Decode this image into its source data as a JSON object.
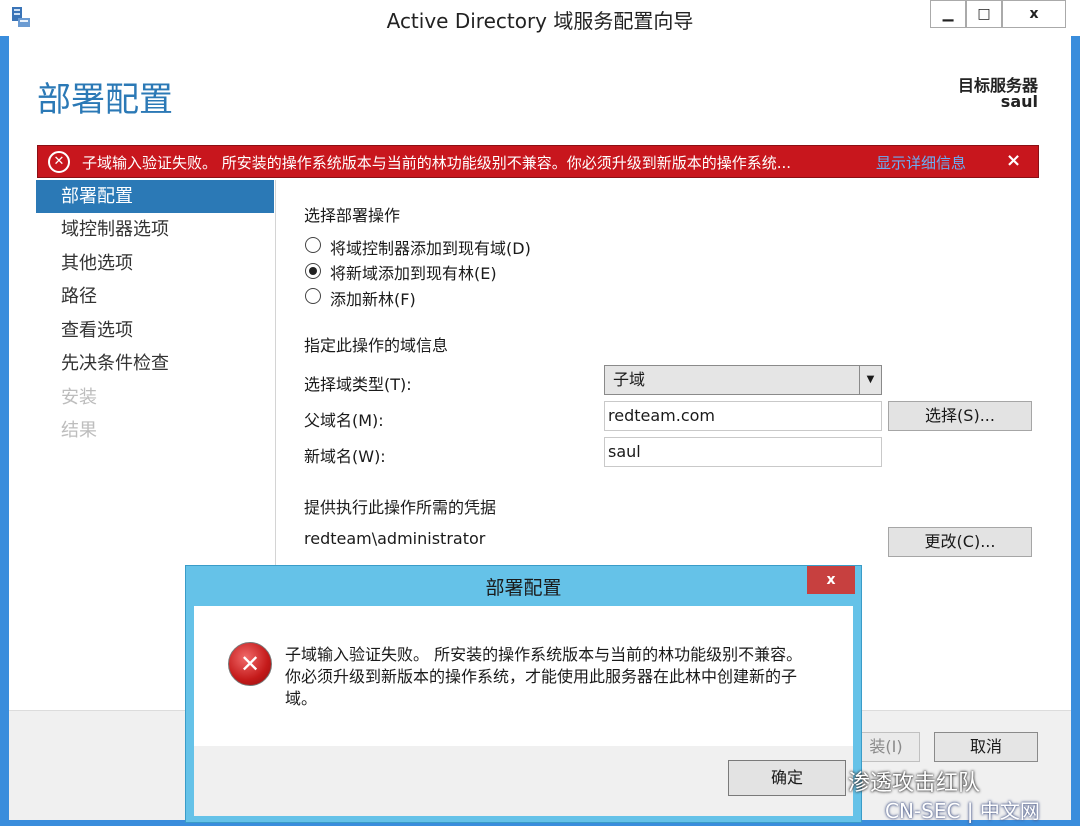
{
  "window": {
    "title": "Active Directory 域服务配置向导",
    "controls": {
      "minimize": "▁",
      "maximize": "□",
      "close": "x"
    }
  },
  "header": {
    "page_title": "部署配置",
    "target_label": "目标服务器",
    "target_name": "saul"
  },
  "error_bar": {
    "text": "子域输入验证失败。 所安装的操作系统版本与当前的林功能级别不兼容。你必须升级到新版本的操作系统...",
    "link": "显示详细信息",
    "close": "×"
  },
  "sidebar": {
    "items": [
      {
        "label": "部署配置",
        "state": "active"
      },
      {
        "label": "域控制器选项",
        "state": "normal"
      },
      {
        "label": "其他选项",
        "state": "normal"
      },
      {
        "label": "路径",
        "state": "normal"
      },
      {
        "label": "查看选项",
        "state": "normal"
      },
      {
        "label": "先决条件检查",
        "state": "normal"
      },
      {
        "label": "安装",
        "state": "disabled"
      },
      {
        "label": "结果",
        "state": "disabled"
      }
    ]
  },
  "main": {
    "deploy_heading": "选择部署操作",
    "radios": [
      {
        "label": "将域控制器添加到现有域(D)",
        "checked": false
      },
      {
        "label": "将新域添加到现有林(E)",
        "checked": true
      },
      {
        "label": "添加新林(F)",
        "checked": false
      }
    ],
    "domain_heading": "指定此操作的域信息",
    "domain_type_label": "选择域类型(T):",
    "domain_type_value": "子域",
    "parent_label": "父域名(M):",
    "parent_value": "redteam.com",
    "select_button": "选择(S)...",
    "new_label": "新域名(W):",
    "new_value": "saul",
    "cred_heading": "提供执行此操作所需的凭据",
    "cred_value": "redteam\\administrator",
    "change_button": "更改(C)..."
  },
  "footer": {
    "install_button": "装(I)",
    "cancel_button": "取消"
  },
  "dialog": {
    "title": "部署配置",
    "close": "x",
    "message": "子域输入验证失败。 所安装的操作系统版本与当前的林功能级别不兼容。你必须升级到新版本的操作系统，才能使用此服务器在此林中创建新的子域。",
    "ok_button": "确定"
  },
  "watermark": {
    "line1": "渗透攻击红队",
    "line2": "CN-SEC | 中文网"
  },
  "colors": {
    "accent": "#2b79b6",
    "error": "#c8161d",
    "dialog_frame": "#65c2e8",
    "window_frame": "#3a8ddc"
  }
}
